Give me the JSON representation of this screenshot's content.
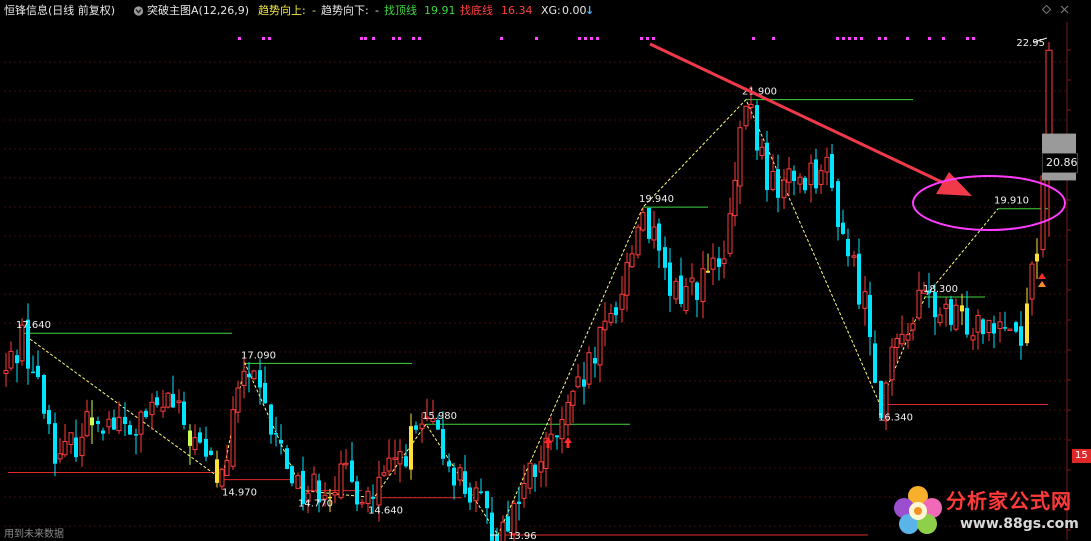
{
  "header": {
    "stock_title": "恒锋信息(日线 前复权)",
    "indicator_name": "突破主图A(12,26,9)",
    "trend_up_label": "趋势向上:",
    "trend_up_value": "-",
    "trend_down_label": "趋势向下:",
    "trend_down_value": "-",
    "top_line_label": "找顶线",
    "top_line_value": "19.91",
    "bottom_line_label": "找底线",
    "bottom_line_value": "16.34",
    "xg_label": "XG:",
    "xg_value": "0.00",
    "xg_arrow": "↓"
  },
  "footer_note": "用到未来数据",
  "watermark": {
    "title": "分析家公式网",
    "url": "www.88gs.com"
  },
  "right_axis": {
    "current_price": "20.86",
    "bottom_label": "15"
  },
  "colors": {
    "up": "#ff3c3c",
    "down": "#00e5ff",
    "yellow_bar": "#ffe135",
    "highlight_bar": "#c8ff50",
    "green_level": "#3dd63d",
    "red_level": "#e02828",
    "zigzag": "#ffff80",
    "signal_dots": "#ff44ff",
    "annotation_arrow": "#f03a4a",
    "annotation_ellipse": "#ff3cff",
    "current_box": "#9a9a9a"
  },
  "chart_data": {
    "type": "candlestick",
    "title": "恒锋信息(日线 前复权)",
    "price_range": [
      13.7,
      23.2
    ],
    "swing_points": [
      {
        "label": "17.640",
        "price": 17.64,
        "kind": "high"
      },
      {
        "label": "14.970",
        "price": 14.97,
        "kind": "low"
      },
      {
        "label": "17.090",
        "price": 17.09,
        "kind": "high"
      },
      {
        "label": "14.770",
        "price": 14.77,
        "kind": "low"
      },
      {
        "label": "14.640",
        "price": 14.64,
        "kind": "low"
      },
      {
        "label": "15.980",
        "price": 15.98,
        "kind": "high"
      },
      {
        "label": "13.96",
        "price": 13.96,
        "kind": "low"
      },
      {
        "label": "19.940",
        "price": 19.94,
        "kind": "high"
      },
      {
        "label": "21.900",
        "price": 21.9,
        "kind": "high"
      },
      {
        "label": "16.340",
        "price": 16.34,
        "kind": "low"
      },
      {
        "label": "18.300",
        "price": 18.3,
        "kind": "high"
      },
      {
        "label": "19.910",
        "price": 19.91,
        "kind": "high"
      },
      {
        "label": "22.95",
        "price": 22.95,
        "kind": "high"
      }
    ],
    "resistance_levels": [
      17.64,
      17.09,
      15.98,
      19.94,
      21.9,
      18.3,
      19.91
    ],
    "support_levels": [
      15.1,
      14.97,
      14.77,
      14.64,
      13.96,
      16.34
    ],
    "last_close": 20.86,
    "last_high": 22.95
  }
}
